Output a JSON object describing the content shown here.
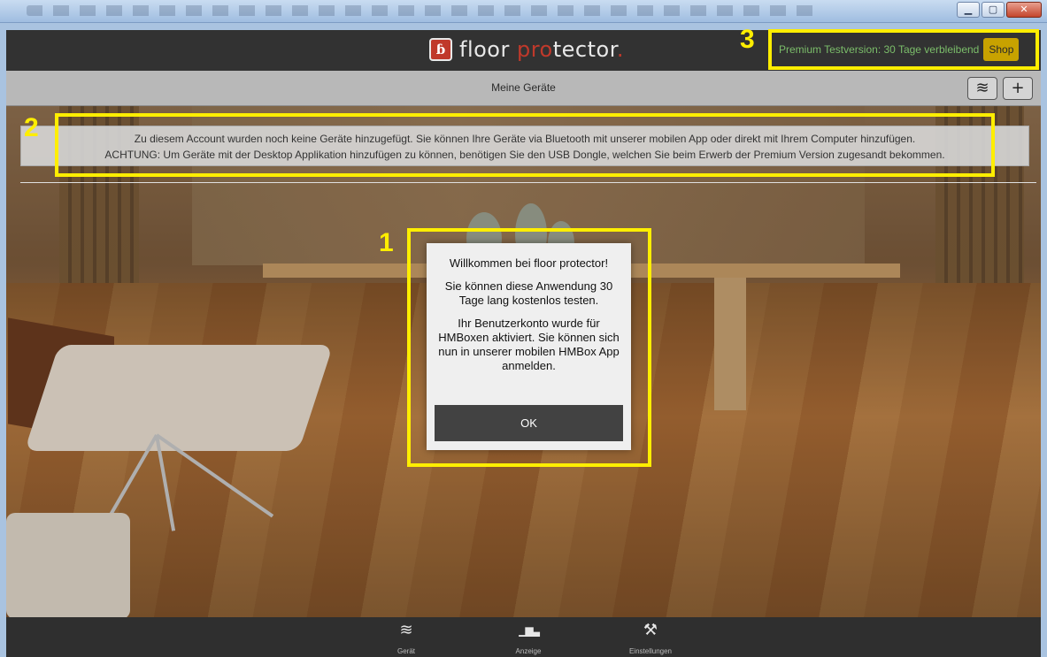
{
  "window": {
    "minimize_glyph": "▁",
    "maximize_glyph": "▢",
    "close_glyph": "✕"
  },
  "header": {
    "logo_badge": "ɓ",
    "logo_word1": "floor ",
    "logo_word2_red": "pro",
    "logo_word3": "tector",
    "logo_dot": ".",
    "trial_text": "Premium Testversion: 30 Tage verbleibend",
    "shop_label": "Shop",
    "marker": "3"
  },
  "subheader": {
    "title": "Meine Geräte",
    "wifi_icon": "wifi-icon",
    "wifi_glyph": "≋",
    "add_glyph": "+"
  },
  "info": {
    "marker": "2",
    "line1": "Zu diesem Account wurden noch keine Geräte hinzugefügt. Sie können Ihre Geräte via Bluetooth mit unserer mobilen App oder direkt mit Ihrem Computer hinzufügen.",
    "line2": "ACHTUNG: Um Geräte mit der Desktop Applikation hinzufügen zu können, benötigen Sie den USB Dongle, welchen Sie beim Erwerb der Premium Version zugesandt bekommen."
  },
  "dialog": {
    "marker": "1",
    "title": "Willkommen bei floor protector!",
    "paragraph1": "Sie können diese Anwendung 30 Tage lang kostenlos testen.",
    "paragraph2": "Ihr Benutzerkonto wurde für HMBoxen aktiviert. Sie können sich nun in unserer mobilen HMBox App anmelden.",
    "ok_label": "OK"
  },
  "bottom_nav": {
    "items": [
      {
        "label": "Gerät",
        "icon": "layers-icon",
        "glyph": "≋"
      },
      {
        "label": "Anzeige",
        "icon": "bar-chart-icon",
        "glyph": "▁▆▃"
      },
      {
        "label": "Einstellungen",
        "icon": "tools-icon",
        "glyph": "⚒"
      }
    ]
  },
  "colors": {
    "highlight": "#ffee00",
    "trial_text": "#7bbd6a",
    "shop_bg": "#c8a200",
    "logo_red": "#c0392b"
  }
}
